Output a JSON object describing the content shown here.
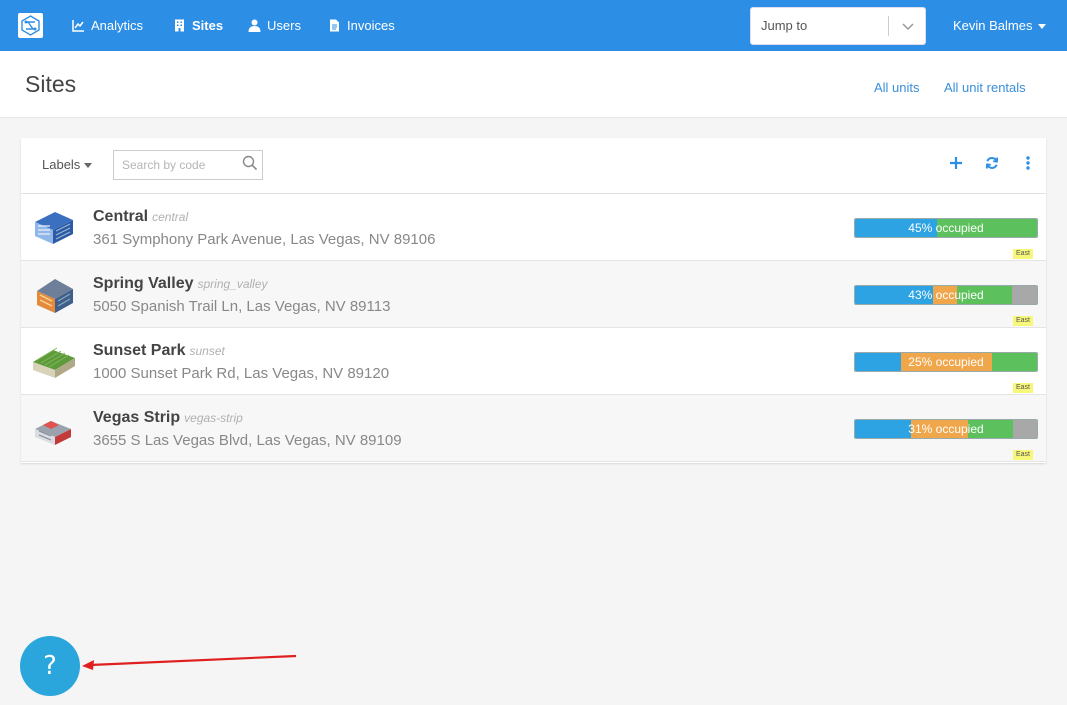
{
  "nav": {
    "items": [
      {
        "label": "Analytics",
        "icon": "chart-icon"
      },
      {
        "label": "Sites",
        "icon": "building-icon",
        "active": true
      },
      {
        "label": "Users",
        "icon": "user-icon"
      },
      {
        "label": "Invoices",
        "icon": "document-icon"
      }
    ],
    "jump_placeholder": "Jump to",
    "user_name": "Kevin Balmes"
  },
  "header": {
    "title": "Sites",
    "links": [
      "All units",
      "All unit rentals"
    ]
  },
  "toolbar": {
    "labels_label": "Labels",
    "search_placeholder": "Search by code"
  },
  "sites": [
    {
      "name": "Central",
      "code": "central",
      "address": "361 Symphony Park Avenue, Las Vegas, NV 89106",
      "occupancy_label": "45% occupied",
      "occupied": 0.45,
      "tag": "East",
      "segments": [
        {
          "color": "#2ea3e3",
          "frac": 0.45
        },
        {
          "color": "#5cc05c",
          "frac": 0.55
        }
      ]
    },
    {
      "name": "Spring Valley",
      "code": "spring_valley",
      "address": "5050 Spanish Trail Ln, Las Vegas, NV 89113",
      "occupancy_label": "43% occupied",
      "occupied": 0.43,
      "tag": "East",
      "segments": [
        {
          "color": "#2ea3e3",
          "frac": 0.43
        },
        {
          "color": "#f0a64a",
          "frac": 0.13
        },
        {
          "color": "#5cc05c",
          "frac": 0.3
        },
        {
          "color": "#a8a8a8",
          "frac": 0.14
        }
      ]
    },
    {
      "name": "Sunset Park",
      "code": "sunset",
      "address": "1000 Sunset Park Rd, Las Vegas, NV 89120",
      "occupancy_label": "25% occupied",
      "occupied": 0.25,
      "tag": "East",
      "segments": [
        {
          "color": "#2ea3e3",
          "frac": 0.25
        },
        {
          "color": "#f0a64a",
          "frac": 0.5
        },
        {
          "color": "#5cc05c",
          "frac": 0.25
        }
      ]
    },
    {
      "name": "Vegas Strip",
      "code": "vegas-strip",
      "address": "3655 S Las Vegas Blvd, Las Vegas, NV 89109",
      "occupancy_label": "31% occupied",
      "occupied": 0.31,
      "tag": "East",
      "segments": [
        {
          "color": "#2ea3e3",
          "frac": 0.31
        },
        {
          "color": "#f0a64a",
          "frac": 0.31
        },
        {
          "color": "#5cc05c",
          "frac": 0.25
        },
        {
          "color": "#a8a8a8",
          "frac": 0.13
        }
      ]
    }
  ],
  "help_label": "?",
  "colors": {
    "primary": "#2d8ee6",
    "link": "#3a8fd9",
    "help": "#2aa6dc",
    "annotation_arrow": "#e02020"
  }
}
